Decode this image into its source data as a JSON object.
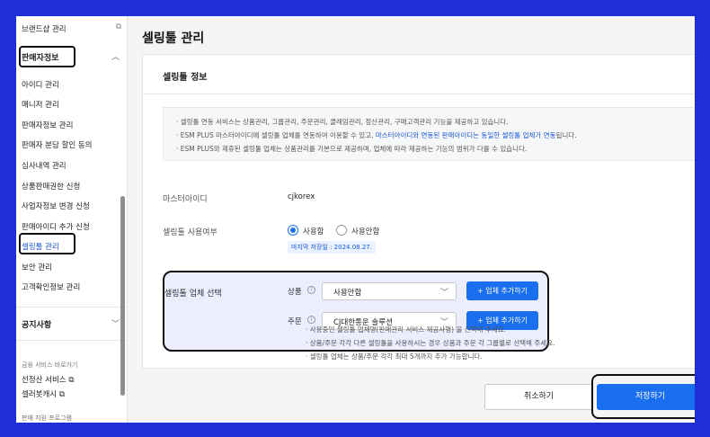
{
  "sidebar": {
    "brandshop": "브랜드샵 관리",
    "section_seller": "판매자정보",
    "items": [
      "아이디 관리",
      "매니저 관리",
      "판매자정보 관리",
      "판매자 분담 할인 동의",
      "심사내역 관리",
      "상품판매권한 신청",
      "사업자정보 변경 신청",
      "판매아이디 추가 신청",
      "셀링툴 관리",
      "보안 관리",
      "고객확인정보 관리"
    ],
    "section_notice": "공지사항",
    "quick_title": "금융 서비스 바로가기",
    "quick_items": [
      "선정산 서비스",
      "셀러봇캐시"
    ],
    "support": "판매 지원 프로그램"
  },
  "main": {
    "page_title": "셀링툴 관리",
    "card_title": "셀링툴 정보",
    "notice": {
      "line1": "셀링툴 연동 서비스는 상품관리, 그룹관리, 주문관리, 클레임관리, 정산관리, 구매고객관리 기능을 제공하고 있습니다.",
      "line2_a": "ESM PLUS 마스터아이디에 셀링툴 업체를 연동하여 이용할 수 있고, ",
      "line2_b": "마스터아이디와 연동된 판매아이디는 동일한 셀링툴 업체가 연동",
      "line2_c": "됩니다.",
      "line3": "ESM PLUS와 제휴된 셀링툴 업체는 상품관리를 기본으로 제공하며, 업체에 따라 제공하는 기능의 범위가 다를 수 있습니다."
    },
    "master_id_label": "마스터아이디",
    "master_id_value": "cjkorex",
    "usage_label": "셀링툴 사용여부",
    "usage_on": "사용함",
    "usage_off": "사용안함",
    "last_saved": "마지막 저장일 : 2024.08.27.",
    "vendor_label": "셀링툴 업체 선택",
    "product_label": "상품",
    "product_value": "사용안함",
    "order_label": "주문",
    "order_value": "CJ대한통운 솔루션",
    "add_vendor": "+ 업체 추가하기",
    "hint1": "사용중인 셀링툴 업체명(판매관리 서비스 제공사명) 을 선택해 주세요.",
    "hint2": "상품/주문 각각 다른 셀링툴을 사용하시는 경우 상품과 주문 각 그룹별로 선택해 주세요.",
    "hint3": "셀링툴 업체는 상품/주문 각각 최대 5개까지 추가 가능합니다.",
    "cancel": "취소하기",
    "save": "저장하기"
  },
  "colors": {
    "accent": "#1a6ef0",
    "frame": "#1f2fd8"
  }
}
